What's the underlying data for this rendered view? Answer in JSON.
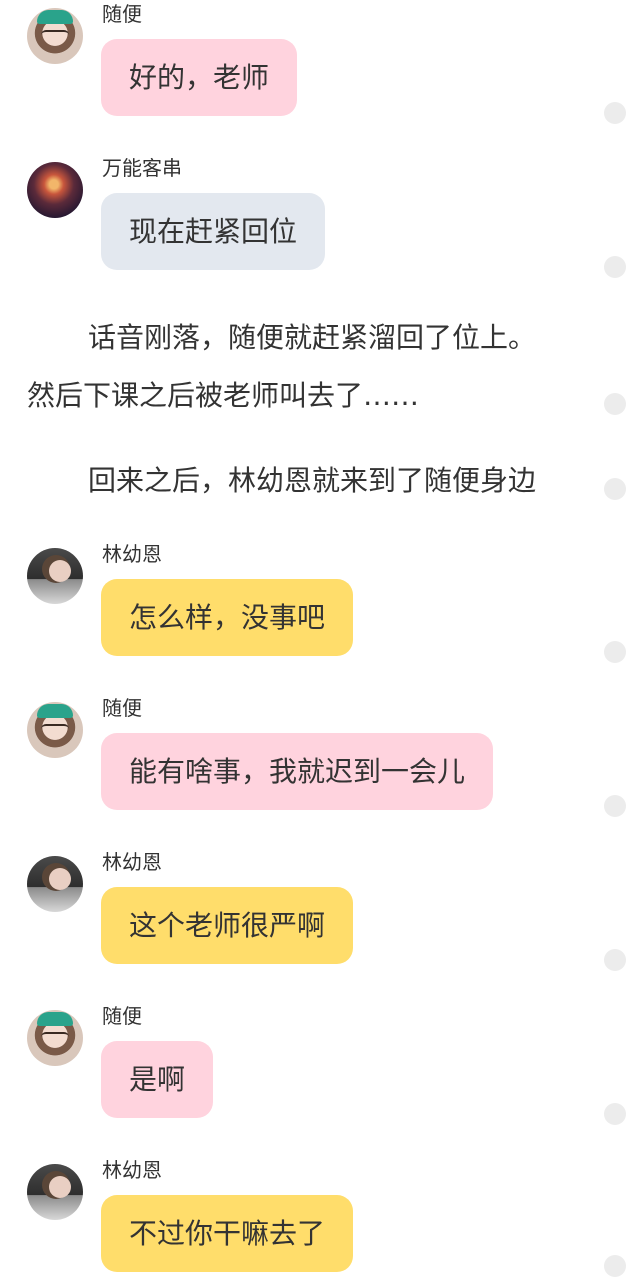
{
  "colors": {
    "pink_bubble": "#ffd3de",
    "gray_bubble": "#e3e8ef",
    "yellow_bubble": "#ffdd6b",
    "text": "#333333",
    "side_dot": "#ececec"
  },
  "messages": [
    {
      "name": "随便",
      "text": "好的，老师",
      "avatar_icon": "girl-teal-hat-avatar",
      "bubble": "pink"
    },
    {
      "name": "万能客串",
      "text": "现在赶紧回位",
      "avatar_icon": "nebula-avatar",
      "bubble": "gray"
    },
    {
      "name": "林幼恩",
      "text": "怎么样，没事吧",
      "avatar_icon": "girl-dark-room-avatar",
      "bubble": "yellow"
    },
    {
      "name": "随便",
      "text": "能有啥事，我就迟到一会儿",
      "avatar_icon": "girl-teal-hat-avatar",
      "bubble": "pink"
    },
    {
      "name": "林幼恩",
      "text": "这个老师很严啊",
      "avatar_icon": "girl-dark-room-avatar",
      "bubble": "yellow"
    },
    {
      "name": "随便",
      "text": "是啊",
      "avatar_icon": "girl-teal-hat-avatar",
      "bubble": "pink"
    },
    {
      "name": "林幼恩",
      "text": "不过你干嘛去了",
      "avatar_icon": "girl-dark-room-avatar",
      "bubble": "yellow"
    }
  ],
  "narration": [
    "话音刚落，随便就赶紧溜回了位上。",
    "然后下课之后被老师叫去了……",
    "回来之后，林幼恩就来到了随便身边"
  ]
}
